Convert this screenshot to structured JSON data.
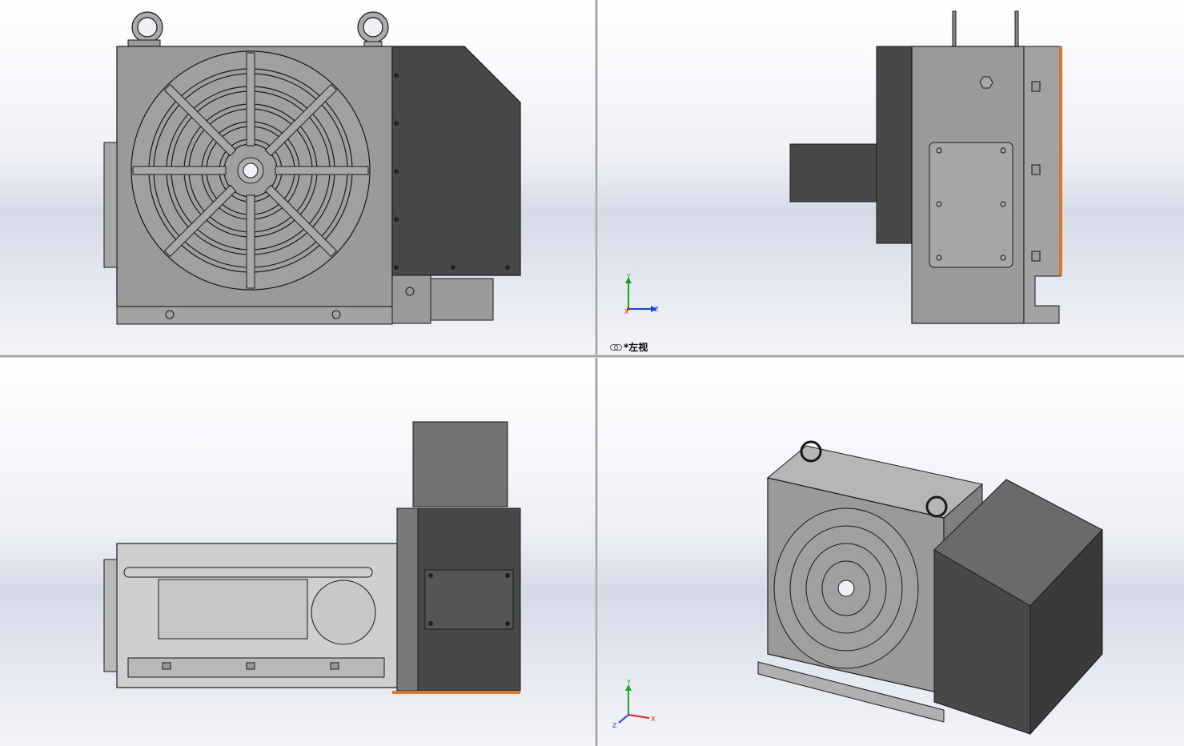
{
  "viewports": {
    "top_right": {
      "view_label": "*左视",
      "triad": {
        "x": "X",
        "y": "Y",
        "z": "Z"
      }
    },
    "bottom_right": {
      "triad": {
        "x": "X",
        "y": "Y",
        "z": "Z"
      }
    }
  },
  "colors": {
    "body_gray": "#9a9a9a",
    "dark_motor": "#484848",
    "edge": "#1a1a1a",
    "orange_plate": "#d9782a",
    "axis_x": "#e02020",
    "axis_y": "#20a020",
    "axis_z": "#2040d0"
  }
}
